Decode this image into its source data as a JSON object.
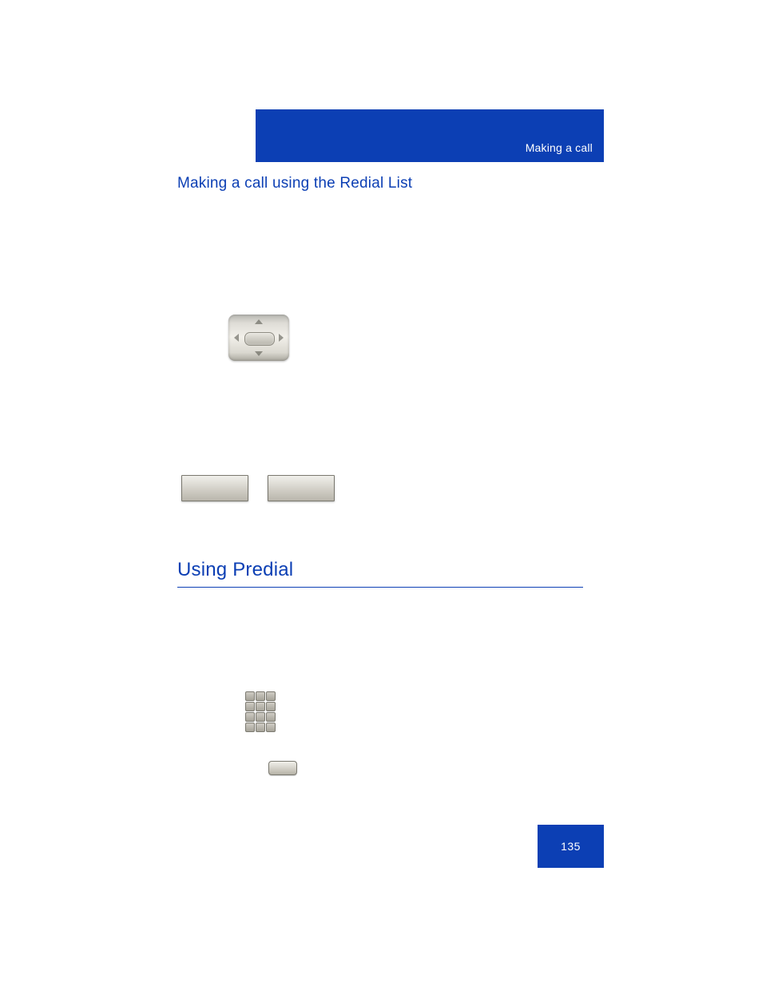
{
  "header": {
    "running_title": "Making a call"
  },
  "subheading": {
    "text": "Making a call using the Redial List"
  },
  "section": {
    "heading": "Using Predial"
  },
  "icons": {
    "nav_pad": "navigation-keypad-icon",
    "softkey_left": "softkey",
    "softkey_right": "softkey",
    "dialpad": "dialpad-icon",
    "small_softkey": "softkey"
  },
  "page": {
    "number": "135"
  }
}
